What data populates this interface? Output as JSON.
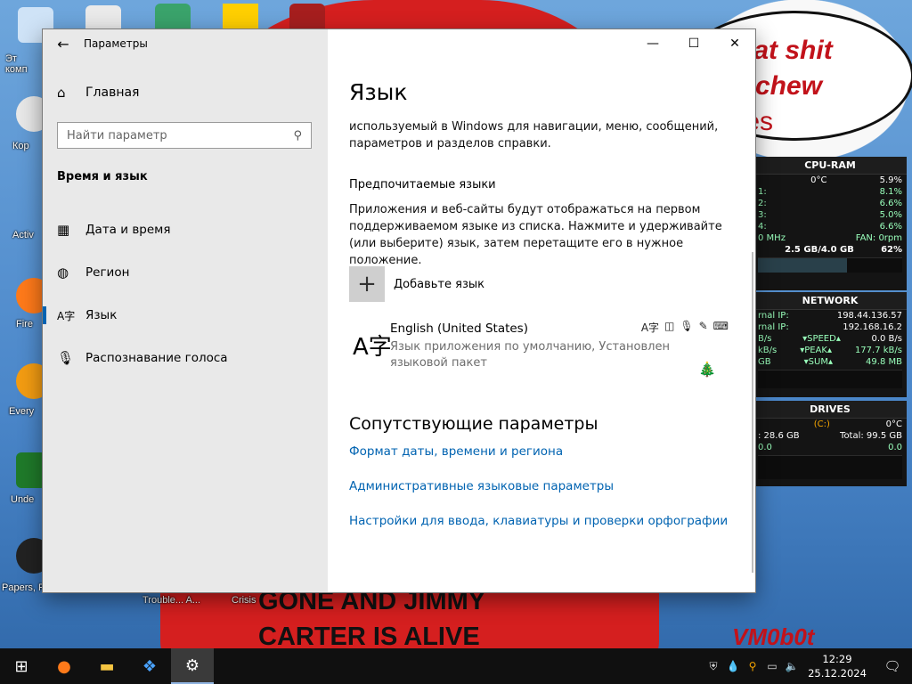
{
  "desktop": {
    "speech_line1": "o eat shit",
    "speech_line2": "nd chew",
    "speech_line3": "anes",
    "poster_line1": "GONE AND JIMMY",
    "poster_line2": "CARTER IS ALIVE",
    "signature": "VM0b0t",
    "icons": [
      {
        "label": "Эт\nкомп"
      },
      {
        "label": "Кор"
      },
      {
        "label": "Activ"
      },
      {
        "label": "Fire"
      },
      {
        "label": "Every"
      },
      {
        "label": "Unde"
      },
      {
        "label": "Papers, P"
      },
      {
        "label": "Trouble... A..."
      },
      {
        "label": "Crisis"
      }
    ]
  },
  "widgets": {
    "cpu": {
      "title": "CPU-RAM",
      "temp": "0°C",
      "total": "5.9%",
      "cores": [
        {
          "label": "1:",
          "value": "8.1%"
        },
        {
          "label": "2:",
          "value": "6.6%"
        },
        {
          "label": "3:",
          "value": "5.0%"
        },
        {
          "label": "4:",
          "value": "6.6%"
        }
      ],
      "freq": "0 MHz",
      "fan": "FAN: 0rpm",
      "ram": "2.5 GB/4.0 GB",
      "ram_pct": "62%",
      "ram_fill": 0.62
    },
    "network": {
      "title": "NETWORK",
      "ext_label": "rnal IP:",
      "ext_ip": "198.44.136.57",
      "int_label": "rnal IP:",
      "int_ip": "192.168.16.2",
      "speed_left": "B/s",
      "speed_label": "▾SPEED▴",
      "speed_right": "0.0 B/s",
      "peak_left": "kB/s",
      "peak_label": "▾PEAK▴",
      "peak_right": "177.7 kB/s",
      "sum_left": "GB",
      "sum_label": "▾SUM▴",
      "sum_right": "49.8 MB"
    },
    "drives": {
      "title": "DRIVES",
      "drive": "(C:)",
      "temp": "0°C",
      "used": ": 28.6 GB",
      "total": "Total: 99.5 GB",
      "r1": "0.0",
      "r2": "0.0"
    }
  },
  "window": {
    "title": "Параметры",
    "back_icon": "←",
    "minimize": "—",
    "maximize": "☐",
    "close": "✕"
  },
  "sidebar": {
    "home_label": "Главная",
    "search_placeholder": "Найти параметр",
    "section_title": "Время и язык",
    "items": [
      {
        "label": "Дата и время",
        "icon": "calendar-icon"
      },
      {
        "label": "Регион",
        "icon": "globe-icon"
      },
      {
        "label": "Язык",
        "icon": "language-icon",
        "selected": true
      },
      {
        "label": "Распознавание голоса",
        "icon": "microphone-icon"
      }
    ]
  },
  "content": {
    "page_title": "Язык",
    "intro_text": "используемый в Windows для навигации, меню, сообщений, параметров и разделов справки.",
    "preferred_heading": "Предпочитаемые языки",
    "preferred_text": "Приложения и веб-сайты будут отображаться на первом поддерживаемом языке из списка. Нажмите и удерживайте (или выберите) язык, затем перетащите его в нужное положение.",
    "add_language": "Добавьте язык",
    "language_name": "English (United States)",
    "language_desc": "Язык приложения по умолчанию, Установлен языковой пакет",
    "related_title": "Сопутствующие параметры",
    "links": [
      "Формат даты, времени и региона",
      "Административные языковые параметры",
      "Настройки для ввода, клавиатуры и проверки орфографии"
    ]
  },
  "taskbar": {
    "time": "12:29",
    "date": "25.12.2024"
  }
}
